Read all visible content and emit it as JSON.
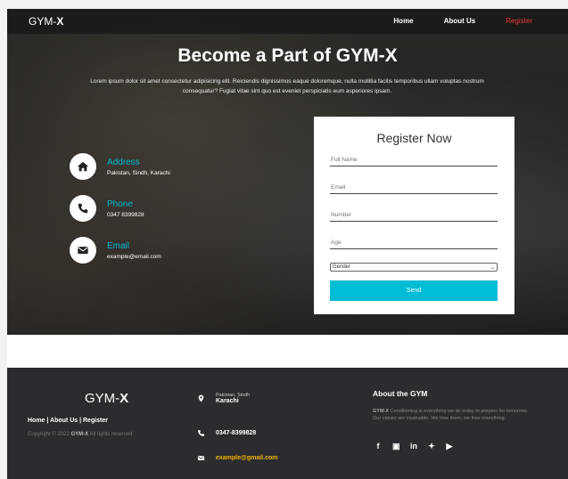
{
  "brand": {
    "name_prefix": "GYM-",
    "name_suffix": "X"
  },
  "nav": {
    "items": [
      "Home",
      "About Us",
      "Register"
    ],
    "active": "Register"
  },
  "hero": {
    "title": "Become a Part of GYM-X",
    "subtitle": "Lorem ipsum dolor sit amet consectetur adipisicing elit. Reiciendis dignissimos eaque doloremque, nulla mollitia facilis temporibus ullam voluptas nostrum consequatur? Fugiat vitae sint quo est eveniet perspiciatis eum asperiores ipsam."
  },
  "contacts": [
    {
      "label": "Address",
      "value": "Pakistan, Sindh, Karachi",
      "icon": "home-icon"
    },
    {
      "label": "Phone",
      "value": "0347 8399828",
      "icon": "phone-icon"
    },
    {
      "label": "Email",
      "value": "example@email.com",
      "icon": "envelope-icon"
    }
  ],
  "form": {
    "title": "Register Now",
    "placeholders": {
      "full_name": "Full Name",
      "email": "Email",
      "number": "Number",
      "age": "Age"
    },
    "gender_selected": "Gender",
    "send_label": "Send"
  },
  "footer": {
    "logo_prefix": "GYM-",
    "logo_suffix": "X",
    "links": "Home | About Us | Register",
    "copyright_pre": "Copyright © 2022 ",
    "copyright_brand": "GYM-X",
    "copyright_post": " All rights reserved",
    "address_line1": "Pakistan, Sindh",
    "address_line2": "Karachi",
    "phone": "0347-8399828",
    "email": "example@gmail.com",
    "about_title": "About the GYM",
    "about_brand": "GYM-X",
    "about_text_1": " Conditioning is everything we do today to prepare for tomorrow.",
    "about_text_2": "Our values are invaluable. We lose them, we lose everything.",
    "socials": [
      "f",
      "ig",
      "in",
      "tw",
      "yt"
    ]
  },
  "colors": {
    "accent": "#00bcd4",
    "active_nav": "#e53935",
    "email_link": "#f0b400",
    "footer_bg": "#2c2b2f"
  }
}
